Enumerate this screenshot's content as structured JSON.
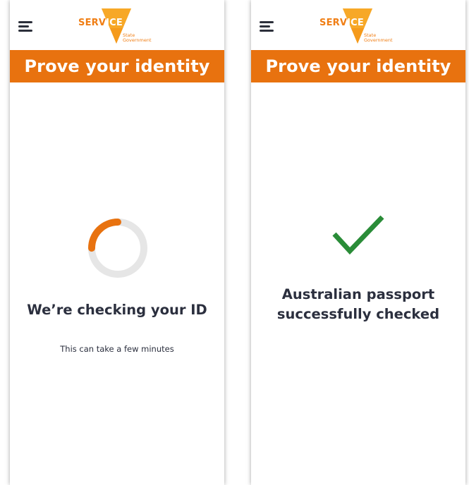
{
  "screens": [
    {
      "logo": {
        "brand": "SERVICE",
        "brand_part1": "SERV",
        "brand_part2": "ICE",
        "sub_line1": "State",
        "sub_line2": "Government"
      },
      "title": "Prove your identity",
      "status_heading": "We’re checking your ID",
      "status_subtext": "This can take a few minutes",
      "spinner_progress": 0.25
    },
    {
      "logo": {
        "brand": "SERVICE",
        "brand_part1": "SERV",
        "brand_part2": "ICE",
        "sub_line1": "State",
        "sub_line2": "Government"
      },
      "title": "Prove your identity",
      "status_heading": "Australian passport successfully checked"
    }
  ],
  "colors": {
    "accent_orange": "#e8720f",
    "logo_orange": "#f07e14",
    "success_green": "#2a8c38",
    "spinner_track": "#e6e6e6",
    "text_dark": "#2b2f3e"
  },
  "icons": {
    "menu": "hamburger-menu-icon",
    "spinner": "loading-spinner-icon",
    "success": "checkmark-icon"
  }
}
